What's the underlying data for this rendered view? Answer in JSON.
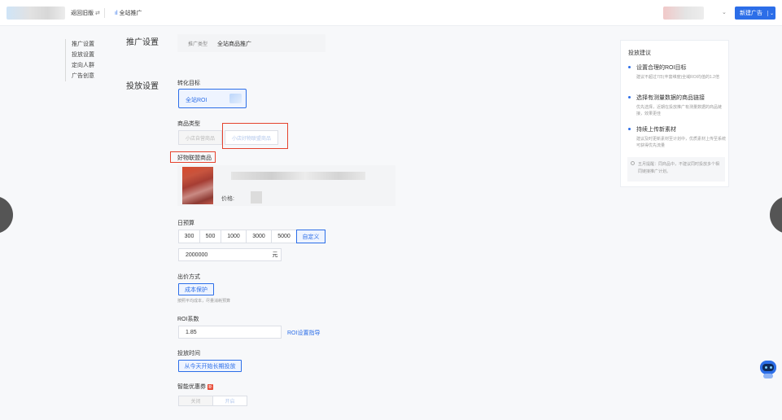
{
  "topbar": {
    "back_label": "返回旧版",
    "back_swap_icon": "⇄",
    "breadcrumb_icon": "bar-chart-icon",
    "breadcrumb_icon_glyph": "ıl",
    "breadcrumb_label": "全站推广",
    "user_caret": "⌄",
    "new_ad_label": "新建广告",
    "new_ad_caret": "⌄"
  },
  "sidenav": {
    "items": [
      {
        "label": "推广设置"
      },
      {
        "label": "投放设置"
      },
      {
        "label": "定向人群"
      },
      {
        "label": "广告创意"
      }
    ]
  },
  "promo_settings": {
    "section_title": "推广设置",
    "plan_type_key": "推广类型",
    "plan_type_value": "全站商品推广"
  },
  "delivery_settings": {
    "section_title": "投放设置",
    "goal_label": "转化目标",
    "goal_option": "全站ROI",
    "goods_type_label": "商品类型",
    "goods_type_options": [
      {
        "label": "小店自营商品",
        "state": "disabled"
      },
      {
        "label": "小店好物联盟商品",
        "state": "selected-disabled"
      }
    ],
    "affiliate_goods_label": "好物联盟商品",
    "product_price_label": "价格:",
    "daily_budget_label": "日预算",
    "budget_options": [
      "300",
      "500",
      "1000",
      "3000",
      "5000",
      "自定义"
    ],
    "budget_active": "自定义",
    "budget_value": "2000000",
    "budget_unit": "元",
    "bid_method_label": "出价方式",
    "bid_method_option": "成本保护",
    "bid_method_hint": "按照平均成本，尽量消耗预算",
    "roi_label": "ROI系数",
    "roi_value": "1.85",
    "roi_guide_link": "ROI设置指导",
    "schedule_label": "投放时间",
    "schedule_option": "从今天开始长期投放",
    "coupon_label": "智能优惠券",
    "coupon_badge": "新",
    "coupon_options": [
      "关闭",
      "开启"
    ]
  },
  "tips": {
    "title": "投放建议",
    "items": [
      {
        "heading": "设置合理的ROI目标",
        "detail": "建议不超过7日(丰富维度)全域ROI均值的1.2倍"
      },
      {
        "heading": "选择有测量数据的商品链接",
        "detail": "优先选择，近期在投放推广有测量数据的商品链接，效果更佳"
      },
      {
        "heading": "持续上传新素材",
        "detail": "建议及时更新素材至计划中，优质素材上传至系统可获得优先流量"
      }
    ],
    "note": "五月提醒：同商品中，不建议同时投放多个相同链接推广计划。"
  },
  "colors": {
    "accent": "#2c6ee8",
    "highlight_box": "#e5432e",
    "badge": "#e5432e"
  }
}
